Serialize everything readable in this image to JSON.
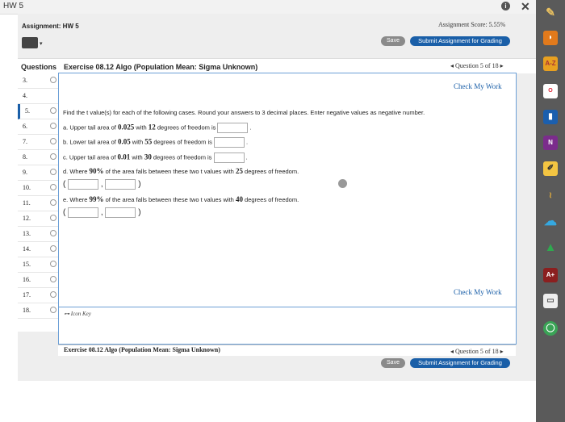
{
  "window": {
    "title": "HW 5"
  },
  "header": {
    "assignment": "Assignment: HW 5",
    "score": "Assignment Score: 5.55%",
    "save": "Save",
    "submit": "Submit Assignment for Grading"
  },
  "questions_label": "Questions",
  "exercise_title": "Exercise 08.12 Algo (Population Mean: Sigma Unknown)",
  "question_nav": "Question 5 of 18",
  "question_numbers": [
    "3.",
    "4.",
    "5.",
    "6.",
    "7.",
    "8.",
    "9.",
    "10.",
    "11.",
    "12.",
    "13.",
    "14.",
    "15.",
    "16.",
    "17.",
    "18."
  ],
  "check_my_work": "Check My Work",
  "problem": {
    "intro": "Find the t value(s) for each of the following cases. Round your answers to 3 decimal places. Enter negative values as negative number.",
    "a_pre": "a. Upper tail area of ",
    "a_v1": "0.025",
    "a_mid": " with ",
    "a_v2": "12",
    "a_post": " degrees of freedom is",
    "b_pre": "b. Lower tail area of ",
    "b_v1": "0.05",
    "b_mid": " with ",
    "b_v2": "55",
    "b_post": " degrees of freedom is",
    "c_pre": "c. Upper tail area of ",
    "c_v1": "0.01",
    "c_mid": " with ",
    "c_v2": "30",
    "c_post": " degrees of freedom is",
    "d_pre": "d. Where ",
    "d_v1": "90%",
    "d_mid": " of the area falls between these two t values with ",
    "d_v2": "25",
    "d_post": " degrees of freedom.",
    "e_pre": "e. Where ",
    "e_v1": "99%",
    "e_mid": " of the area falls between these two t values with ",
    "e_v2": "40",
    "e_post": " degrees of freedom."
  },
  "icon_key": "Icon Key",
  "colors": {
    "accent": "#1a5fa8",
    "border": "#6c9fd6"
  }
}
